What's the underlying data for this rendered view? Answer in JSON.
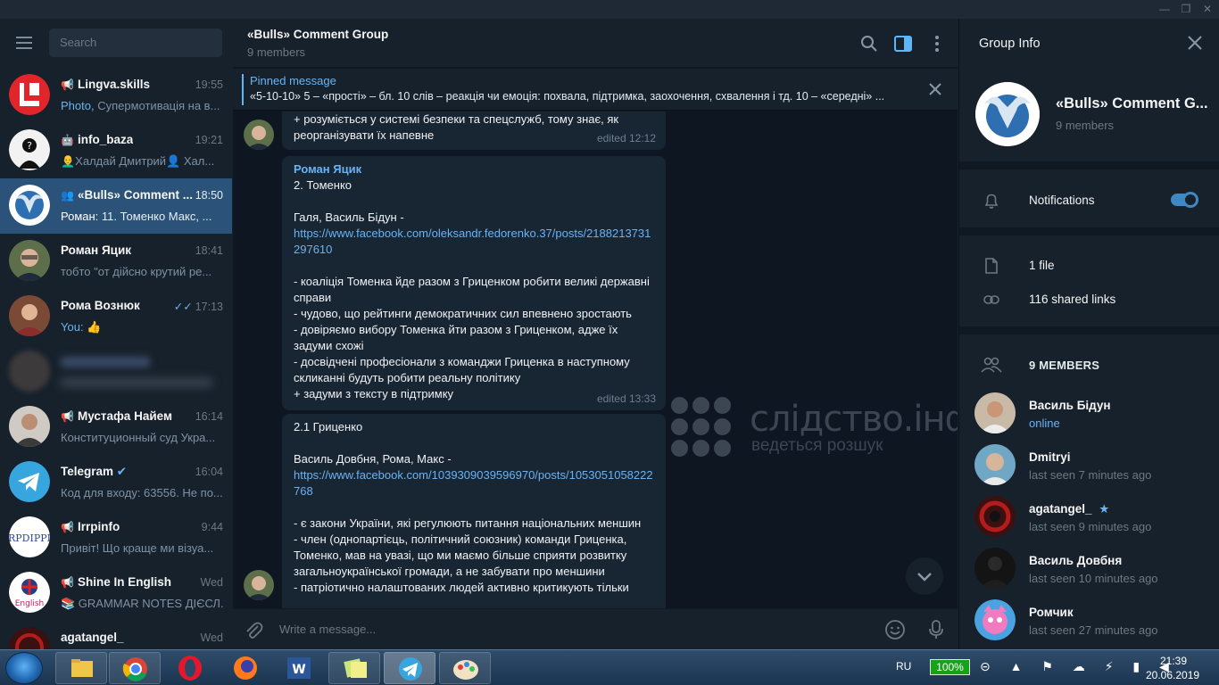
{
  "window": {
    "minimize": "—",
    "maximize": "❐",
    "close": "✕"
  },
  "left": {
    "search_placeholder": "Search",
    "chats": [
      {
        "name": "Lingva.skills",
        "time": "19:55",
        "prefix": "Photo, ",
        "preview": "Супермотивація на в...",
        "type": "channel"
      },
      {
        "name": "info_baza",
        "time": "19:21",
        "prefix": "",
        "preview": "👨‍🦲Халдай Дмитрий👤 Хал...",
        "type": "bot"
      },
      {
        "name": "«Bulls» Comment ...",
        "time": "18:50",
        "prefix": "Роман: ",
        "preview": "11. Томенко  Макс, ...",
        "type": "group"
      },
      {
        "name": "Роман Яцик",
        "time": "18:41",
        "prefix": "",
        "preview": "тобто \"от дійсно крутий ре...",
        "type": "user"
      },
      {
        "name": "Рома Вознюк",
        "time": "17:13",
        "prefix": "You: ",
        "preview": "👍",
        "type": "user"
      },
      {
        "name": "",
        "time": "",
        "prefix": "",
        "preview": "",
        "type": "blurred"
      },
      {
        "name": "Мустафа Найем",
        "time": "16:14",
        "prefix": "",
        "preview": "Конституционный суд Укра...",
        "type": "channel"
      },
      {
        "name": "Telegram",
        "time": "16:04",
        "prefix": "",
        "preview": "Код для входу: 63556. Не по...",
        "type": "verified"
      },
      {
        "name": "Irrpinfo",
        "time": "9:44",
        "prefix": "",
        "preview": "Привіт!  Що краще ми візуа...",
        "type": "channel"
      },
      {
        "name": "Shine In English",
        "time": "Wed",
        "prefix": "",
        "preview": "📚 GRAMMAR NOTES ДІЄСЛ...",
        "type": "channel"
      },
      {
        "name": "agatangel_",
        "time": "Wed",
        "prefix": "",
        "preview": "",
        "type": "user"
      }
    ]
  },
  "chat": {
    "title": "«Bulls» Comment Group",
    "subtitle": "9 members",
    "pinned_title": "Pinned message",
    "pinned_text": "«5-10-10»  5 – «прості» – бл. 10 слів – реакція чи емоція: похвала, підтримка, заохочення, схвалення і тд. 10 – «середні» ...",
    "msg0_lines": [
      "+ розуміється у системі безпеки та спецслужб, тому знає, як",
      "реорганізувати їх напевне"
    ],
    "msg0_edited": "edited 12:12",
    "msg1_sender": "Роман Яцик",
    "msg1_head": "2. Томенко",
    "msg1_names": "Галя, Василь Бідун -",
    "msg1_link": "https://www.facebook.com/oleksandr.fedorenko.37/posts/2188213731297610",
    "msg1_body": "- коаліція Томенка йде разом з Гриценком робити великі державні справи\n- чудово, що рейтинги демократичних сил впевнено зростають\n- довіряємо вибору Томенка йти разом з Гриценком, адже їх задуми схожі\n- досвідчені професіонали з команджи Гриценка в наступному скликанні будуть робити реальну політику\n+ задуми з тексту в підтримку",
    "msg1_edited": "edited 13:33",
    "msg2_head": "2.1 Гриценко",
    "msg2_names": "Василь Довбня, Рома, Макс -",
    "msg2_link": "https://www.facebook.com/1039309039596970/posts/1053051058222768",
    "msg2_body": "- є закони України, які регулюють питання національних меншин\n- член (однопартієць, політичний союзник) команди Гриценка, Томенко, мав на увазі, що ми маємо більше сприяти розвитку загальноукраїнської громади, а не забувати про меншини\n- патріотично налаштованих людей активно критикують тільки",
    "watermark_main": "слідство.інфо",
    "watermark_sub": "ведеться розшук",
    "input_placeholder": "Write a message..."
  },
  "info": {
    "title": "Group Info",
    "group_name": "«Bulls» Comment G...",
    "group_members": "9 members",
    "notifications_label": "Notifications",
    "notifications_on": true,
    "files_label": "1 file",
    "links_label": "116 shared links",
    "members_header": "9 MEMBERS",
    "members": [
      {
        "name": "Василь Бідун",
        "status": "online",
        "online": true
      },
      {
        "name": "Dmitryi",
        "status": "last seen 7 minutes ago",
        "online": false
      },
      {
        "name": "agatangel_",
        "status": "last seen 9 minutes ago",
        "online": false,
        "star": "★"
      },
      {
        "name": "Василь Довбня",
        "status": "last seen 10 minutes ago",
        "online": false
      },
      {
        "name": "Ромчик",
        "status": "last seen 27 minutes ago",
        "online": false
      }
    ]
  },
  "taskbar": {
    "lang": "RU",
    "battery": "100%",
    "time": "21:39",
    "date": "20.06.2019"
  },
  "colors": {
    "accent": "#6ab3f3",
    "active_chat": "#2b5278",
    "bg_dark": "#0e1621",
    "panel": "#17212b"
  }
}
